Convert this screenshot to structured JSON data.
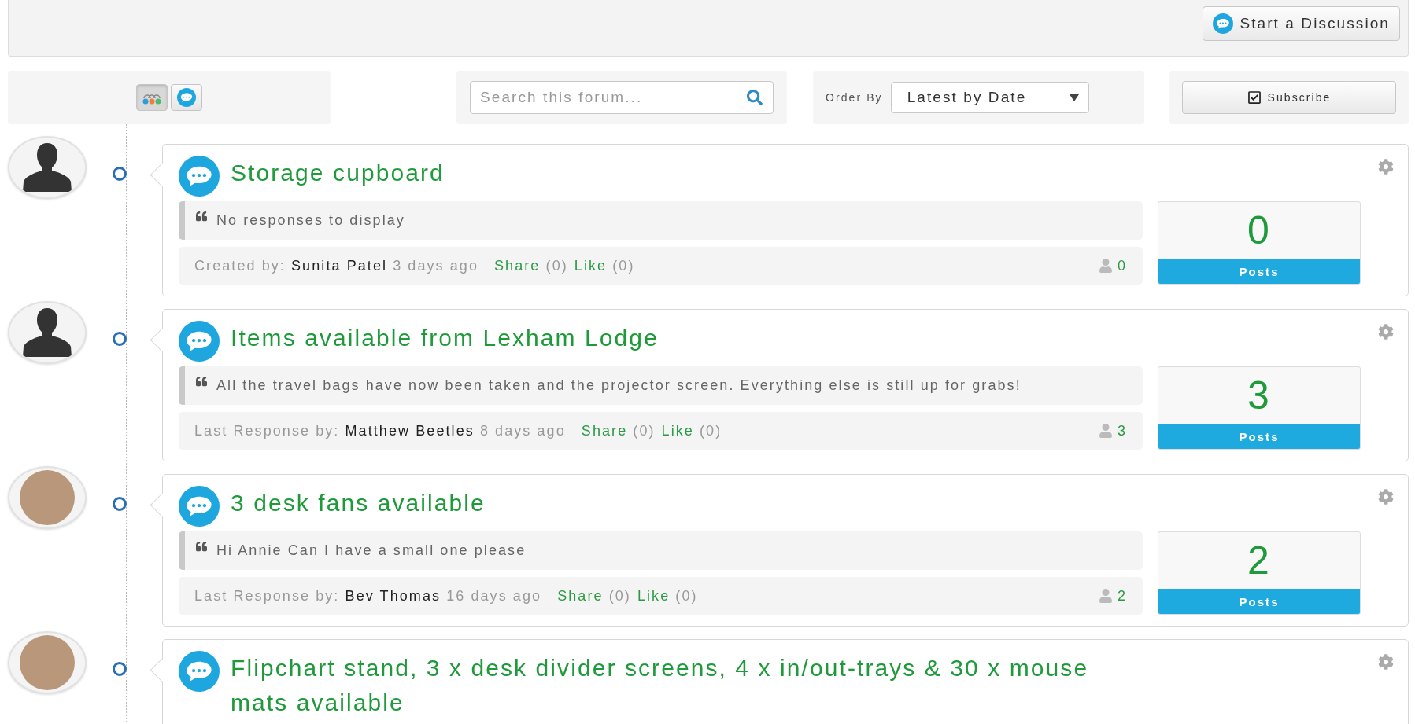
{
  "header": {
    "start_button": "Start a Discussion"
  },
  "toolbar": {
    "view_toggles": [
      {
        "kind": "grouped",
        "selected": true
      },
      {
        "kind": "bubble",
        "selected": false
      }
    ],
    "search": {
      "placeholder": "Search this forum..."
    },
    "order": {
      "label": "Order By",
      "value": "Latest by Date"
    },
    "subscribe": "Subscribe"
  },
  "discussions": [
    {
      "avatar": {
        "kind": "silhouette"
      },
      "title": "Storage cupboard",
      "excerpt": "No responses to display",
      "meta": {
        "label": "Created by:",
        "author": "Sunita Patel",
        "time": "3 days ago",
        "share": "Share",
        "share_count": "(0)",
        "like": "Like",
        "like_count": "(0)",
        "participants": "0"
      },
      "posts": {
        "count": "0",
        "label": "Posts"
      }
    },
    {
      "avatar": {
        "kind": "silhouette"
      },
      "title": "Items available from Lexham Lodge",
      "excerpt": "All the travel bags have now been taken and the projector screen. Everything else is still up for grabs!",
      "meta": {
        "label": "Last Response by:",
        "author": "Matthew Beetles",
        "time": "8 days ago",
        "share": "Share",
        "share_count": "(0)",
        "like": "Like",
        "like_count": "(0)",
        "participants": "3"
      },
      "posts": {
        "count": "3",
        "label": "Posts"
      }
    },
    {
      "avatar": {
        "kind": "photo"
      },
      "title": "3 desk fans available",
      "excerpt": "Hi Annie Can I have a small one please",
      "meta": {
        "label": "Last Response by:",
        "author": "Bev Thomas",
        "time": "16 days ago",
        "share": "Share",
        "share_count": "(0)",
        "like": "Like",
        "like_count": "(0)",
        "participants": "2"
      },
      "posts": {
        "count": "2",
        "label": "Posts"
      }
    },
    {
      "avatar": {
        "kind": "photo"
      },
      "title": "Flipchart stand, 3 x desk divider screens, 4 x in/out-trays & 30 x mouse mats available"
    }
  ]
}
